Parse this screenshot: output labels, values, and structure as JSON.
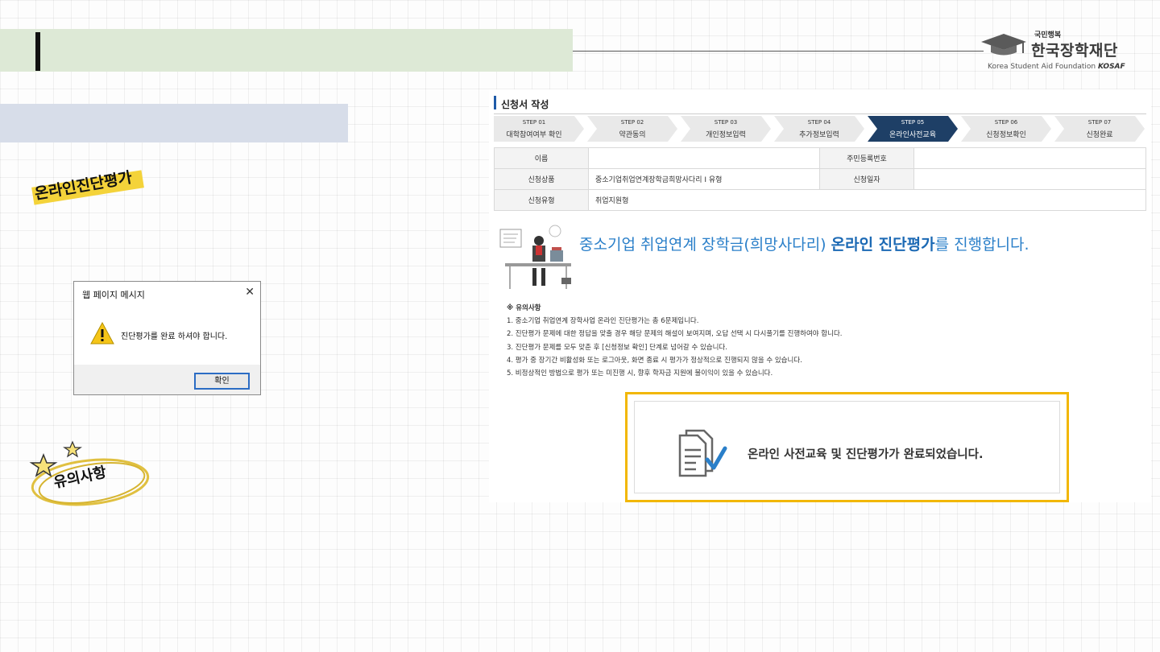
{
  "logo": {
    "top": "국민행복",
    "kr": "한국장학재단",
    "en": "Korea Student Aid Foundation",
    "en_brand": "KOSAF"
  },
  "labels": {
    "diagnosis": "온라인진단평가",
    "notice": "유의사항"
  },
  "dialog": {
    "title": "웹 페이지 메시지",
    "close": "✕",
    "message": "진단평가를 완료 하셔야 합니다.",
    "ok": "확인"
  },
  "form": {
    "title": "신청서 작성",
    "steps": [
      {
        "num": "STEP 01",
        "label": "대학참여여부 확인"
      },
      {
        "num": "STEP 02",
        "label": "약관동의"
      },
      {
        "num": "STEP 03",
        "label": "개인정보입력"
      },
      {
        "num": "STEP 04",
        "label": "추가정보입력"
      },
      {
        "num": "STEP 05",
        "label": "온라인사전교육"
      },
      {
        "num": "STEP 06",
        "label": "신청정보확인"
      },
      {
        "num": "STEP 07",
        "label": "신청완료"
      }
    ],
    "active_step": 5,
    "table": {
      "name_label": "이름",
      "rrn_label": "주민등록번호",
      "product_label": "신청상품",
      "product_value": "중소기업취업연계장학금희망사다리 I 유형",
      "date_label": "신청일자",
      "type_label": "신청유형",
      "type_value": "취업지원형"
    },
    "headline_pre": "중소기업 취업연계 장학금(희망사다리) ",
    "headline_bold": "온라인 진단평가",
    "headline_post": "를 진행합니다.",
    "notes_title": "※ 유의사항",
    "notes": [
      "1. 중소기업 취업연계 장학사업 온라인 진단평가는 총 6문제입니다.",
      "2. 진단평가 문제에 대한 정답을 맞출 경우 해당 문제의 해설이 보여지며, 오답 선택 시 다시풀기를 진행하여야 합니다.",
      "3. 진단평가 문제를 모두 맞춘 후 [신청정보 확인] 단계로 넘어갈 수 있습니다.",
      "4. 평가 중 장기간 비활성화 또는 로그아웃, 화면 종료 시 평가가 정상적으로 진행되지 않을 수 있습니다.",
      "5. 비정상적인 방법으로 평가 또는 미진행 시, 향후 학자금 지원에 불이익이 있을 수 있습니다."
    ]
  },
  "completion": {
    "message": "온라인 사전교육 및 진단평가가 완료되었습니다."
  },
  "colors": {
    "accent_blue": "#2a7fc9",
    "active_step": "#1e3f66",
    "highlight_yellow": "#f2b705"
  }
}
